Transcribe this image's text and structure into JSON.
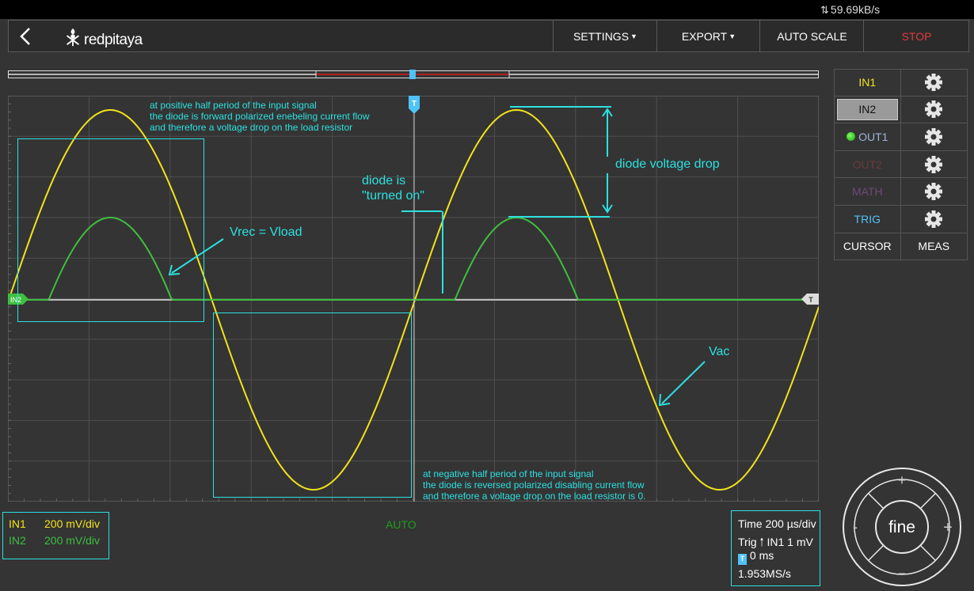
{
  "status_bar": {
    "transfer_rate": "59.69kB/s"
  },
  "header": {
    "logo_text": "redpitaya",
    "buttons": {
      "settings": "SETTINGS",
      "export": "EXPORT",
      "auto_scale": "AUTO SCALE",
      "stop": "STOP"
    }
  },
  "colors": {
    "in1": "#f2e31c",
    "in2": "#3fbf3f",
    "annotation": "#2de0e0",
    "stop": "#e03b3b",
    "trig": "#4fc3f7"
  },
  "channels_panel": {
    "rows": [
      {
        "label": "IN1",
        "icon": "gear-icon"
      },
      {
        "label": "IN2",
        "icon": "gear-icon"
      },
      {
        "label": "OUT1",
        "icon": "gear-icon"
      },
      {
        "label": "OUT2",
        "icon": "gear-icon"
      },
      {
        "label": "MATH",
        "icon": "gear-icon"
      },
      {
        "label": "TRIG",
        "icon": "gear-icon"
      }
    ],
    "cursor": "CURSOR",
    "meas": "MEAS"
  },
  "plot": {
    "in2_marker": "IN2",
    "trigger_marker": "T",
    "annotations": {
      "positive_half": [
        "at positive half period of the input signal",
        "the diode is forward polarized enebeling current flow",
        "and therefore a voltage drop on the load resistor"
      ],
      "negative_half": [
        "at negative half period of the input signal",
        "the diode is reversed polarized disabling current flow",
        "and therefore a voltage drop on the load resistor is 0."
      ],
      "diode_on": [
        "diode is",
        "\"turned on\""
      ],
      "diode_drop": "diode voltage drop",
      "vrec": "Vrec = Vload",
      "vac": "Vac"
    }
  },
  "scales": {
    "in1_label": "IN1",
    "in1_value": "200 mV/div",
    "in2_label": "IN2",
    "in2_value": "200 mV/div"
  },
  "acquisition_mode": "AUTO",
  "timebase": {
    "time": "Time 200 µs/div",
    "trig": "Trig",
    "trig_source": "IN1 1 mV",
    "delay": "0 ms",
    "sample_rate": "1.953MS/s"
  },
  "jog": {
    "center": "fine",
    "plus": "+",
    "minus": "-",
    "up": "+",
    "down": "−"
  }
}
